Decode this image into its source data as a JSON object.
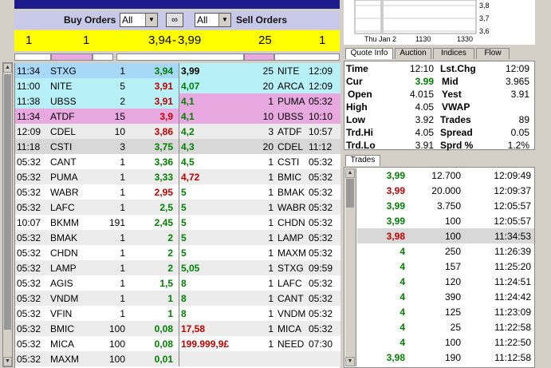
{
  "header": {
    "buy_label": "Buy Orders",
    "sell_label": "Sell Orders",
    "buy_filter": "All",
    "sell_filter": "All"
  },
  "summary": {
    "buy_count": "1",
    "buy_size": "1",
    "buy_price": "3,94",
    "sep": "-",
    "sell_price": "3,99",
    "sell_size": "25",
    "sell_count": "1"
  },
  "chart": {
    "y_ticks": [
      "3,8",
      "3,7",
      "3,6"
    ],
    "x_ticks": [
      "Thu Jan 2",
      "1130",
      "1330"
    ]
  },
  "tabs": [
    "Quote Info",
    "Auction",
    "Indices",
    "Flow"
  ],
  "quote": {
    "time": {
      "label": "Time",
      "value": "12:10"
    },
    "lstchg": {
      "label": "Lst.Chg",
      "value": "12:09"
    },
    "cur": {
      "label": "Cur",
      "value": "3.99"
    },
    "mid": {
      "label": "Mid",
      "value": "3.965"
    },
    "open": {
      "label": "Open",
      "value": "4.015"
    },
    "yest": {
      "label": "Yest",
      "value": "3.91"
    },
    "high": {
      "label": "High",
      "value": "4.05"
    },
    "vwap": {
      "label": "VWAP",
      "value": ""
    },
    "low": {
      "label": "Low",
      "value": "3.92"
    },
    "trades": {
      "label": "Trades",
      "value": "89"
    },
    "trdhi": {
      "label": "Trd.Hi",
      "value": "4.05"
    },
    "spread": {
      "label": "Spread",
      "value": "0.05"
    },
    "trdlo": {
      "label": "Trd.Lo",
      "value": "3.91"
    },
    "sprd": {
      "label": "Sprd %",
      "value": "1.2%"
    }
  },
  "trades_tab": "Trades",
  "colors": {
    "row_blue": "#a8d8f8",
    "row_cyan": "#b8f0f8",
    "row_pink": "#e8a8e0",
    "row_gray": "#d8d8d8",
    "row_grey2": "#ececec",
    "green": "#008000",
    "red": "#c00000"
  },
  "book": [
    {
      "bt": "11:34",
      "bb": "STXG",
      "bq": "1",
      "bp": "3,94",
      "bpc": "green",
      "sp": "3,99",
      "spc": "black",
      "sq": "25",
      "sb": "NITE",
      "st": "12:09",
      "lbg": "row_blue",
      "rbg": "row_cyan"
    },
    {
      "bt": "11:00",
      "bb": "NITE",
      "bq": "5",
      "bp": "3,91",
      "bpc": "red",
      "sp": "4,07",
      "spc": "green",
      "sq": "20",
      "sb": "ARCA",
      "st": "12:09",
      "lbg": "row_cyan",
      "rbg": "row_cyan"
    },
    {
      "bt": "11:38",
      "bb": "UBSS",
      "bq": "2",
      "bp": "3,91",
      "bpc": "red",
      "sp": "4,1",
      "spc": "green",
      "sq": "1",
      "sb": "PUMA",
      "st": "05:32",
      "lbg": "row_cyan",
      "rbg": "row_pink"
    },
    {
      "bt": "11:34",
      "bb": "ATDF",
      "bq": "15",
      "bp": "3,9",
      "bpc": "red",
      "sp": "4,1",
      "spc": "green",
      "sq": "10",
      "sb": "UBSS",
      "st": "10:10",
      "lbg": "row_pink",
      "rbg": "row_pink"
    },
    {
      "bt": "12:09",
      "bb": "CDEL",
      "bq": "10",
      "bp": "3,86",
      "bpc": "red",
      "sp": "4,2",
      "spc": "green",
      "sq": "3",
      "sb": "ATDF",
      "st": "10:57",
      "lbg": "row_grey2",
      "rbg": "row_grey2"
    },
    {
      "bt": "11:18",
      "bb": "CSTI",
      "bq": "3",
      "bp": "3,75",
      "bpc": "green",
      "sp": "4,3",
      "spc": "green",
      "sq": "20",
      "sb": "CDEL",
      "st": "11:12",
      "lbg": "row_gray",
      "rbg": "row_gray"
    },
    {
      "bt": "05:32",
      "bb": "CANT",
      "bq": "1",
      "bp": "3,36",
      "bpc": "green",
      "sp": "4,5",
      "spc": "green",
      "sq": "1",
      "sb": "CSTI",
      "st": "05:32",
      "lbg": "",
      "rbg": ""
    },
    {
      "bt": "05:32",
      "bb": "PUMA",
      "bq": "1",
      "bp": "3,33",
      "bpc": "green",
      "sp": "4,72",
      "spc": "red",
      "sq": "1",
      "sb": "BMIC",
      "st": "05:32",
      "lbg": "row_grey2",
      "rbg": "row_grey2"
    },
    {
      "bt": "05:32",
      "bb": "WABR",
      "bq": "1",
      "bp": "2,95",
      "bpc": "red",
      "sp": "5",
      "spc": "green",
      "sq": "1",
      "sb": "BMAK",
      "st": "05:32",
      "lbg": "",
      "rbg": ""
    },
    {
      "bt": "05:32",
      "bb": "LAFC",
      "bq": "1",
      "bp": "2,5",
      "bpc": "green",
      "sp": "5",
      "spc": "green",
      "sq": "1",
      "sb": "WABR",
      "st": "05:32",
      "lbg": "row_grey2",
      "rbg": "row_grey2"
    },
    {
      "bt": "10:07",
      "bb": "BKMM",
      "bq": "191",
      "bp": "2,45",
      "bpc": "green",
      "sp": "5",
      "spc": "green",
      "sq": "1",
      "sb": "CHDN",
      "st": "05:32",
      "lbg": "",
      "rbg": ""
    },
    {
      "bt": "05:32",
      "bb": "BMAK",
      "bq": "1",
      "bp": "2",
      "bpc": "green",
      "sp": "5",
      "spc": "green",
      "sq": "1",
      "sb": "LAMP",
      "st": "05:32",
      "lbg": "row_grey2",
      "rbg": "row_grey2"
    },
    {
      "bt": "05:32",
      "bb": "CHDN",
      "bq": "1",
      "bp": "2",
      "bpc": "green",
      "sp": "5",
      "spc": "green",
      "sq": "1",
      "sb": "MAXM",
      "st": "05:32",
      "lbg": "",
      "rbg": ""
    },
    {
      "bt": "05:32",
      "bb": "LAMP",
      "bq": "1",
      "bp": "2",
      "bpc": "green",
      "sp": "5,05",
      "spc": "green",
      "sq": "1",
      "sb": "STXG",
      "st": "09:59",
      "lbg": "row_grey2",
      "rbg": "row_grey2"
    },
    {
      "bt": "05:32",
      "bb": "AGIS",
      "bq": "1",
      "bp": "1,5",
      "bpc": "green",
      "sp": "8",
      "spc": "green",
      "sq": "1",
      "sb": "LAFC",
      "st": "05:32",
      "lbg": "",
      "rbg": ""
    },
    {
      "bt": "05:32",
      "bb": "VNDM",
      "bq": "1",
      "bp": "1",
      "bpc": "green",
      "sp": "8",
      "spc": "green",
      "sq": "1",
      "sb": "CANT",
      "st": "05:32",
      "lbg": "row_grey2",
      "rbg": "row_grey2"
    },
    {
      "bt": "05:32",
      "bb": "VFIN",
      "bq": "1",
      "bp": "1",
      "bpc": "green",
      "sp": "8",
      "spc": "green",
      "sq": "1",
      "sb": "VNDM",
      "st": "05:32",
      "lbg": "",
      "rbg": ""
    },
    {
      "bt": "05:32",
      "bb": "BMIC",
      "bq": "100",
      "bp": "0,08",
      "bpc": "green",
      "sp": "17,58",
      "spc": "red",
      "sq": "1",
      "sb": "MICA",
      "st": "05:32",
      "lbg": "row_grey2",
      "rbg": "row_grey2"
    },
    {
      "bt": "05:32",
      "bb": "MICA",
      "bq": "100",
      "bp": "0,08",
      "bpc": "green",
      "sp": "199.999,9£",
      "spc": "red",
      "sq": "1",
      "sb": "NEED",
      "st": "07:30",
      "lbg": "",
      "rbg": ""
    },
    {
      "bt": "05:32",
      "bb": "MAXM",
      "bq": "100",
      "bp": "0,01",
      "bpc": "green",
      "sp": "",
      "spc": "green",
      "sq": "",
      "sb": "",
      "st": "",
      "lbg": "row_grey2",
      "rbg": "row_grey2"
    }
  ],
  "trades": [
    {
      "p": "3,99",
      "pc": "green",
      "q": "12.700",
      "t": "12:09:49",
      "bg": ""
    },
    {
      "p": "3,99",
      "pc": "red",
      "q": "20.000",
      "t": "12:09:37",
      "bg": ""
    },
    {
      "p": "3,99",
      "pc": "green",
      "q": "3.750",
      "t": "12:05:57",
      "bg": ""
    },
    {
      "p": "3,99",
      "pc": "green",
      "q": "100",
      "t": "12:05:57",
      "bg": ""
    },
    {
      "p": "3,98",
      "pc": "red",
      "q": "100",
      "t": "11:34:53",
      "bg": "row_gray"
    },
    {
      "p": "4",
      "pc": "green",
      "q": "250",
      "t": "11:26:39",
      "bg": ""
    },
    {
      "p": "4",
      "pc": "green",
      "q": "157",
      "t": "11:25:20",
      "bg": ""
    },
    {
      "p": "4",
      "pc": "green",
      "q": "120",
      "t": "11:24:51",
      "bg": ""
    },
    {
      "p": "4",
      "pc": "green",
      "q": "390",
      "t": "11:24:42",
      "bg": ""
    },
    {
      "p": "4",
      "pc": "green",
      "q": "125",
      "t": "11:23:09",
      "bg": ""
    },
    {
      "p": "4",
      "pc": "green",
      "q": "25",
      "t": "11:22:58",
      "bg": ""
    },
    {
      "p": "4",
      "pc": "green",
      "q": "100",
      "t": "11:22:50",
      "bg": ""
    },
    {
      "p": "3,98",
      "pc": "green",
      "q": "190",
      "t": "11:12:58",
      "bg": ""
    }
  ]
}
